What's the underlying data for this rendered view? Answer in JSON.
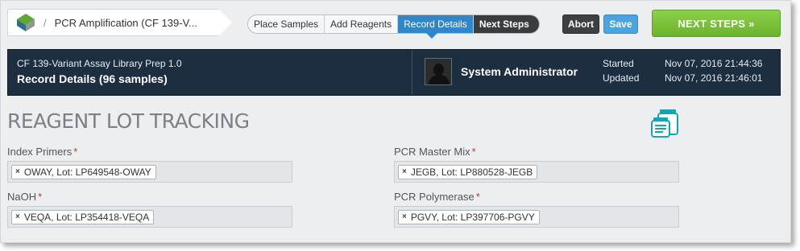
{
  "breadcrumb": {
    "separator": "/",
    "title": "PCR Amplification (CF 139-V..."
  },
  "steps": [
    {
      "label": "Place Samples",
      "state": "normal"
    },
    {
      "label": "Add Reagents",
      "state": "normal"
    },
    {
      "label": "Record Details",
      "state": "active"
    },
    {
      "label": "Next Steps",
      "state": "next"
    }
  ],
  "buttons": {
    "abort": "Abort",
    "save": "Save",
    "next_steps": "NEXT STEPS »"
  },
  "banner": {
    "protocol": "CF 139-Variant Assay Library Prep 1.0",
    "step_title": "Record Details (96 samples)",
    "user": "System Administrator",
    "started_label": "Started",
    "started_value": "Nov 07, 2016 21:44:36",
    "updated_label": "Updated",
    "updated_value": "Nov 07, 2016 21:46:01"
  },
  "reagents": {
    "title": "REAGENT LOT TRACKING",
    "required_marker": "*",
    "remove_glyph": "×",
    "fields": [
      {
        "label": "Index Primers",
        "value": "OWAY, Lot: LP649548-OWAY"
      },
      {
        "label": "PCR Master Mix",
        "value": "JEGB, Lot: LP880528-JEGB"
      },
      {
        "label": "NaOH",
        "value": "VEQA, Lot: LP354418-VEQA"
      },
      {
        "label": "PCR Polymerase",
        "value": "PGVY, Lot: LP397706-PGVY"
      }
    ]
  },
  "colors": {
    "active_step": "#2f86c9",
    "next_button": "#7bc13c",
    "banner": "#1d2e40",
    "required": "#c0392b"
  }
}
